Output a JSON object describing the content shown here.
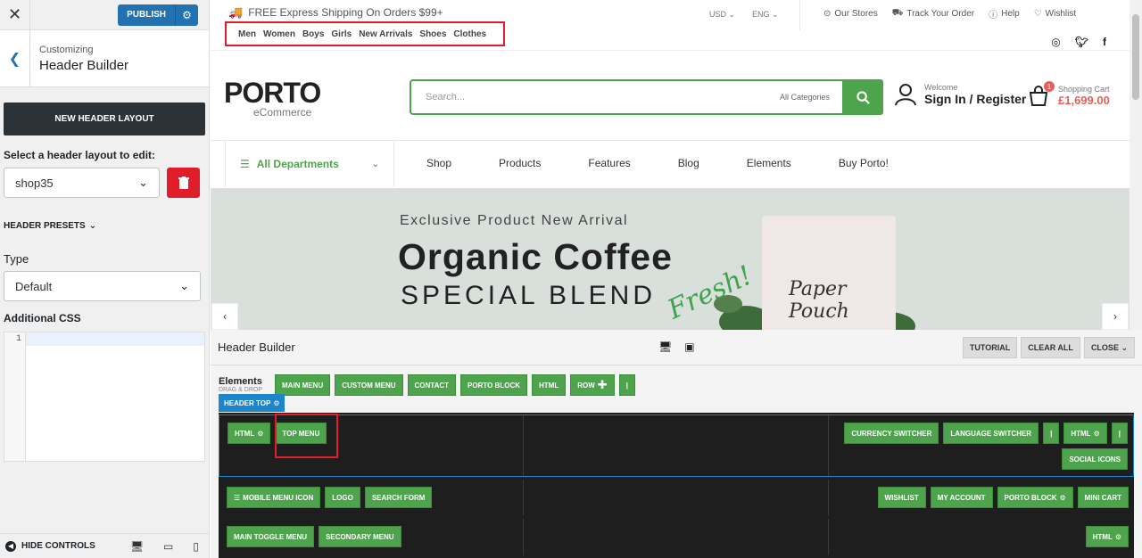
{
  "customizer": {
    "publish_label": "PUBLISH",
    "breadcrumb": "Customizing",
    "title": "Header Builder",
    "new_layout_label": "NEW HEADER LAYOUT",
    "select_label": "Select a header layout to edit:",
    "layout_value": "shop35",
    "presets_label": "HEADER PRESETS",
    "type_label": "Type",
    "type_value": "Default",
    "css_label": "Additional CSS",
    "css_line_no": "1",
    "hide_controls": "HIDE CONTROLS"
  },
  "preview": {
    "shipping": "FREE Express Shipping On Orders $99+",
    "categories": [
      "Men",
      "Women",
      "Boys",
      "Girls",
      "New Arrivals",
      "Shoes",
      "Clothes"
    ],
    "currency": "USD",
    "language": "ENG",
    "top_links": [
      "Our Stores",
      "Track Your Order",
      "Help",
      "Wishlist"
    ],
    "logo_main": "PORTO",
    "logo_sub": "eCommerce",
    "search_placeholder": "Search...",
    "search_category": "All Categories",
    "welcome": "Welcome",
    "signin": "Sign In / Register",
    "cart_label": "Shopping Cart",
    "cart_amount": "£1,699.00",
    "cart_count": "1",
    "departments": "All Departments",
    "menu": [
      "Shop",
      "Products",
      "Features",
      "Blog",
      "Elements",
      "Buy Porto!"
    ],
    "banner_line1": "Exclusive Product New Arrival",
    "banner_line2": "Organic Coffee",
    "banner_line3": "SPECIAL BLEND",
    "banner_script": "Fresh!",
    "pouch_text": "Paper Pouch"
  },
  "builder": {
    "title": "Header Builder",
    "buttons": [
      "TUTORIAL",
      "CLEAR ALL",
      "CLOSE"
    ],
    "elements_title": "Elements",
    "elements_sub": "DRAG & DROP",
    "elements": [
      "MAIN MENU",
      "CUSTOM MENU",
      "CONTACT",
      "PORTO BLOCK",
      "HTML",
      "ROW",
      "|"
    ],
    "header_top_tag": "HEADER TOP",
    "row1_left": [
      "HTML",
      "TOP MENU"
    ],
    "row1_right": [
      "CURRENCY SWITCHER",
      "LANGUAGE SWITCHER",
      "|",
      "HTML",
      "|",
      "SOCIAL ICONS"
    ],
    "row2_left": [
      "MOBILE MENU ICON",
      "LOGO",
      "SEARCH FORM"
    ],
    "row2_right": [
      "WISHLIST",
      "MY ACCOUNT",
      "PORTO BLOCK",
      "MINI CART"
    ],
    "row3_left": [
      "MAIN TOGGLE MENU",
      "SECONDARY MENU"
    ],
    "row3_right": [
      "HTML"
    ]
  },
  "colors": {
    "green": "#4ea44c",
    "blue": "#2271b1",
    "red": "#e01e2b",
    "builder_dark": "#1e1e1e"
  }
}
